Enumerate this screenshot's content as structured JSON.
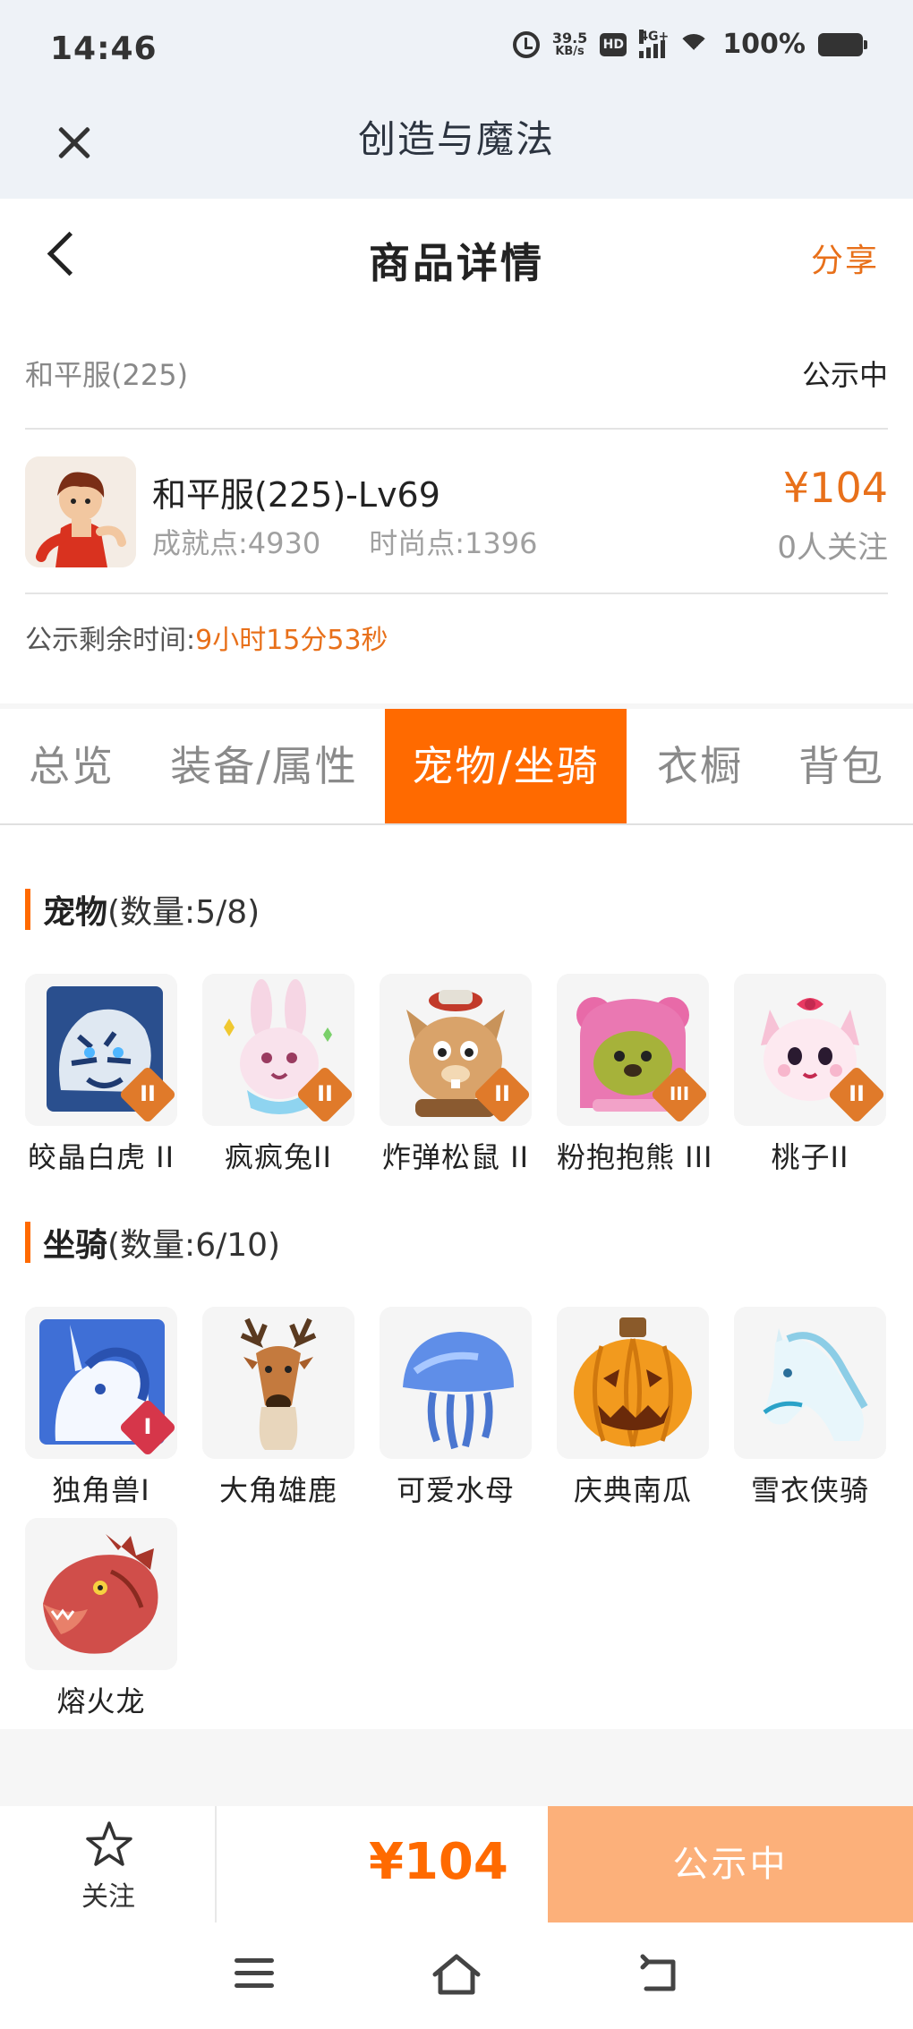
{
  "status_bar": {
    "time": "14:46",
    "net_speed": "39.5",
    "net_unit": "KB/s",
    "hd": "HD",
    "network": "4G+",
    "battery": "100%"
  },
  "app_bar": {
    "title": "创造与魔法"
  },
  "header": {
    "title": "商品详情",
    "share_label": "分享"
  },
  "listing": {
    "server": "和平服(225)",
    "status": "公示中",
    "name": "和平服(225)-Lv69",
    "achievement": "成就点:4930",
    "fashion": "时尚点:1396",
    "price": "¥104",
    "followers": "0人关注",
    "remaining_label": "公示剩余时间:",
    "remaining_value": "9小时15分53秒"
  },
  "tabs": [
    {
      "label": "总览"
    },
    {
      "label": "装备/属性"
    },
    {
      "label": "宠物/坐骑"
    },
    {
      "label": "衣橱"
    },
    {
      "label": "背包"
    }
  ],
  "pets": {
    "title": "宠物",
    "count": "(数量:5/8)",
    "items": [
      {
        "name": "皎晶白虎 II",
        "grade": "II",
        "icon": "white-tiger-icon"
      },
      {
        "name": "疯疯兔II",
        "grade": "II",
        "icon": "crazy-rabbit-icon"
      },
      {
        "name": "炸弹松鼠 II",
        "grade": "II",
        "icon": "bomb-squirrel-icon"
      },
      {
        "name": "粉抱抱熊 III",
        "grade": "III",
        "icon": "pink-bear-icon"
      },
      {
        "name": "桃子II",
        "grade": "II",
        "icon": "peach-cat-icon"
      }
    ]
  },
  "mounts": {
    "title": "坐骑",
    "count": "(数量:6/10)",
    "items": [
      {
        "name": "独角兽I",
        "grade": "I",
        "icon": "unicorn-icon"
      },
      {
        "name": "大角雄鹿",
        "icon": "stag-icon"
      },
      {
        "name": "可爱水母",
        "icon": "jellyfish-icon"
      },
      {
        "name": "庆典南瓜",
        "icon": "pumpkin-icon"
      },
      {
        "name": "雪衣侠骑",
        "icon": "snow-horse-icon"
      },
      {
        "name": "熔火龙",
        "icon": "lava-dragon-icon"
      }
    ]
  },
  "bottom_bar": {
    "follow_label": "关注",
    "price": "¥104",
    "status_label": "公示中"
  },
  "colors": {
    "accent": "#ff6a00",
    "price": "#e8701a",
    "status_button": "#fcb07a"
  }
}
